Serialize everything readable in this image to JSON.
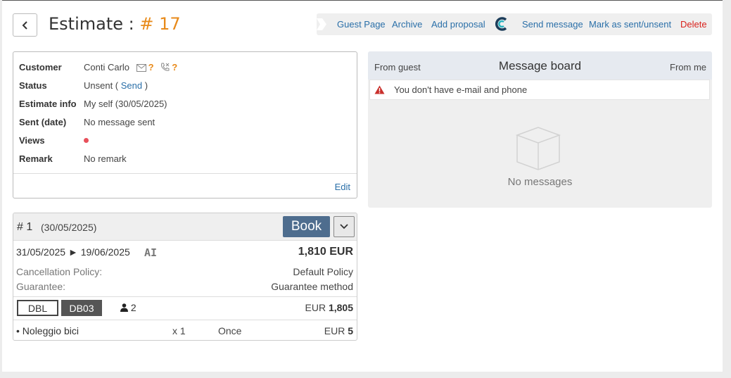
{
  "header": {
    "title_prefix": "Estimate : ",
    "title_number": "# 17"
  },
  "actions": {
    "guest_page": "Guest Page",
    "archive": "Archive",
    "add_proposal": "Add proposal",
    "send_message": "Send message",
    "mark_sent": "Mark as sent/unsent",
    "delete": "Delete"
  },
  "info": {
    "customer_label": "Customer",
    "customer_value": "Conti Carlo",
    "status_label": "Status",
    "status_value": "Unsent (",
    "status_link": "Send",
    "status_close": ")",
    "estimate_info_label": "Estimate info",
    "estimate_info_value": "My self (30/05/2025)",
    "sent_label": "Sent (date)",
    "sent_value": "No message sent",
    "views_label": "Views",
    "remark_label": "Remark",
    "remark_value": "No remark",
    "edit": "Edit",
    "unknown_mark": "?"
  },
  "message_board": {
    "from_guest": "From guest",
    "title": "Message board",
    "from_me": "From me",
    "warning": "You don't have e-mail and phone",
    "empty": "No messages"
  },
  "proposal": {
    "number": "# 1",
    "date": "(30/05/2025)",
    "book": "Book",
    "dates": "31/05/2025 ► 19/06/2025",
    "board": "AI",
    "price": "1,810 EUR",
    "cancellation_label": "Cancellation Policy:",
    "cancellation_value": "Default Policy",
    "guarantee_label": "Guarantee:",
    "guarantee_value": "Guarantee method",
    "room_type": "DBL",
    "rate_code": "DB03",
    "guests": "2",
    "room_currency": "EUR",
    "room_amount": "1,805",
    "extra_name": "• Noleggio bici",
    "extra_qty": "x 1",
    "extra_freq": "Once",
    "extra_currency": "EUR",
    "extra_amount": "5"
  },
  "colors": {
    "accent_orange": "#e88a1a",
    "link_blue": "#2a6fa8",
    "delete_red": "#d9221c",
    "book_button": "#4e6d8e"
  }
}
